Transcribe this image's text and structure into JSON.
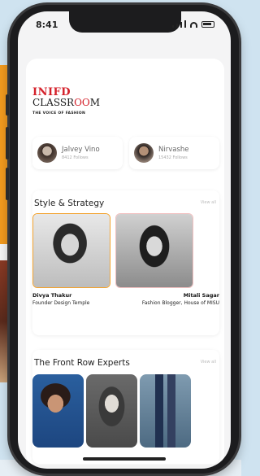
{
  "status_bar": {
    "time": "8:41"
  },
  "logo": {
    "brand_top": "INIFD",
    "brand_main_pre": "CLASSR",
    "brand_main_accent": "OO",
    "brand_main_post": "M",
    "tagline": "THE VOICE OF FASHION"
  },
  "profiles": [
    {
      "name": "Jalvey Vino",
      "subtitle": "8412 Follows"
    },
    {
      "name": "Nirvashe",
      "subtitle": "15432 Follows"
    }
  ],
  "sections": {
    "style_strategy": {
      "title": "Style & Strategy",
      "link": "View all",
      "experts": [
        {
          "name": "Divya Thakur",
          "role": "Founder Design Temple"
        },
        {
          "name": "Mitali Sagar",
          "role": "Fashion Blogger, House of MISU"
        }
      ]
    },
    "front_row": {
      "title": "The Front Row Experts",
      "link": "View all"
    }
  }
}
